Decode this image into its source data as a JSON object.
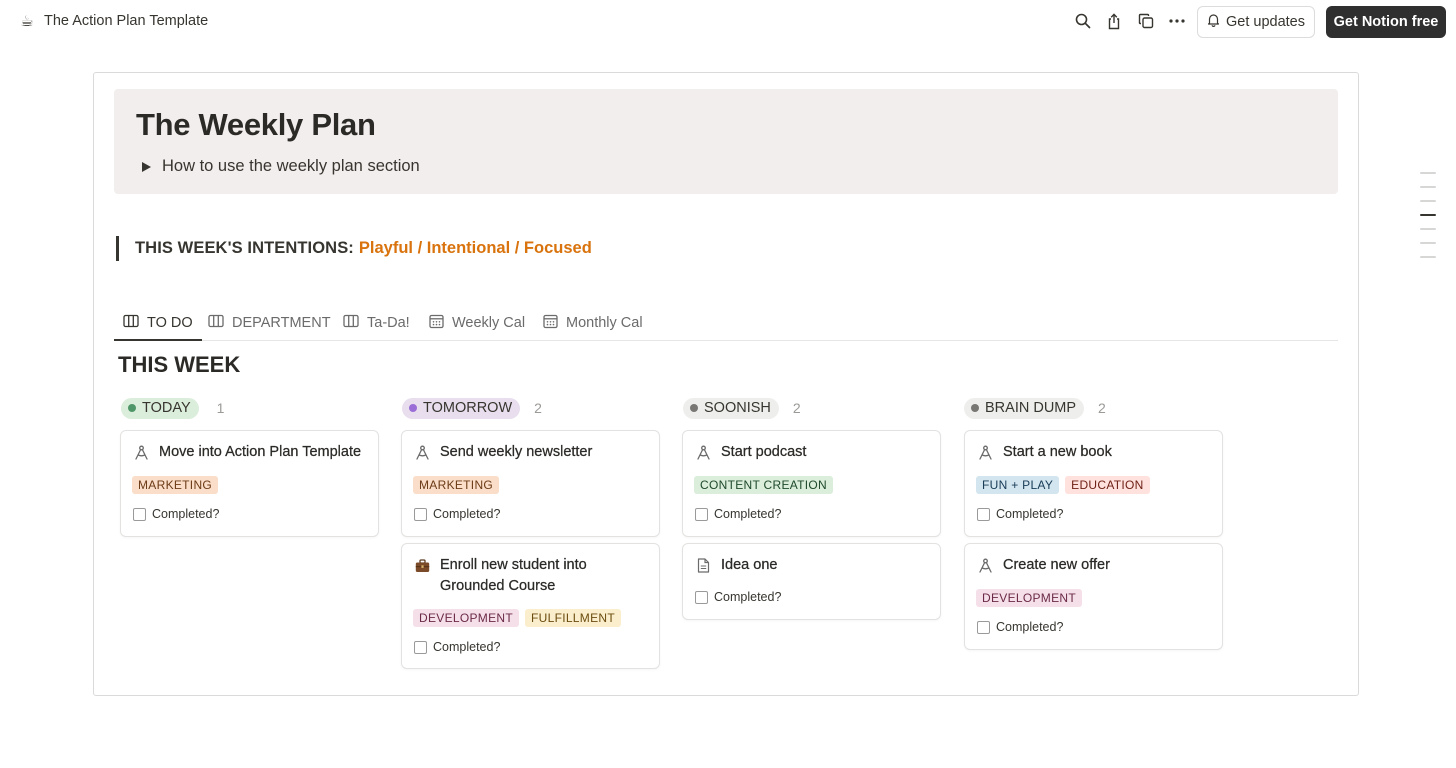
{
  "topbar": {
    "page_icon": "☕",
    "title": "The Action Plan Template",
    "icons": [
      "search-icon",
      "share-icon",
      "duplicate-icon",
      "more-icon"
    ],
    "updates_label": "Get updates",
    "notion_label": "Get Notion free"
  },
  "callout": {
    "title": "The Weekly Plan",
    "toggle_text": "How to use the weekly plan section"
  },
  "intentions": {
    "label": "THIS WEEK'S INTENTIONS:",
    "value": "Playful / Intentional / Focused",
    "value_color": "#d9730d"
  },
  "tabs": [
    {
      "label": "TO DO",
      "icon": "board-icon",
      "active": true
    },
    {
      "label": "DEPARTMENT",
      "icon": "board-icon",
      "active": false
    },
    {
      "label": "Ta-Da!",
      "icon": "board-icon",
      "active": false
    },
    {
      "label": "Weekly Cal",
      "icon": "calendar-icon",
      "active": false
    },
    {
      "label": "Monthly Cal",
      "icon": "calendar-icon",
      "active": false
    }
  ],
  "section_title": "THIS WEEK",
  "checkbox_label": "Completed?",
  "columns": [
    {
      "name": "TODAY",
      "count": "1",
      "pill_color": "#dbeddb",
      "dot_color": "#4f9768",
      "cards": [
        {
          "icon": "compass-icon",
          "title": "Move into Action Plan Template",
          "tags": [
            {
              "label": "MARKETING",
              "bg": "#fadec9",
              "fg": "#6c3b17"
            }
          ]
        }
      ]
    },
    {
      "name": "TOMORROW",
      "count": "2",
      "pill_color": "#e8deee",
      "dot_color": "#9a6dd7",
      "cards": [
        {
          "icon": "compass-icon",
          "title": "Send weekly newsletter",
          "tags": [
            {
              "label": "MARKETING",
              "bg": "#fadec9",
              "fg": "#6c3b17"
            }
          ]
        },
        {
          "icon": "briefcase-icon",
          "title_lines": [
            "Enroll new student into",
            "Grounded Course"
          ],
          "tags": [
            {
              "label": "DEVELOPMENT",
              "bg": "#f5e0e9",
              "fg": "#6b2a47"
            },
            {
              "label": "FULFILLMENT",
              "bg": "#fbeecc",
              "fg": "#6b4c0f"
            }
          ]
        }
      ]
    },
    {
      "name": "SOONISH",
      "count": "2",
      "pill_color": "#eeeeec",
      "dot_color": "#787774",
      "cards": [
        {
          "icon": "compass-icon",
          "title": "Start podcast",
          "tags": [
            {
              "label": "CONTENT CREATION",
              "bg": "#dbeddb",
              "fg": "#1f4a2b"
            }
          ]
        },
        {
          "icon": "document-icon",
          "title": "Idea one",
          "tags": []
        }
      ]
    },
    {
      "name": "BRAIN DUMP",
      "count": "2",
      "pill_color": "#eeeeec",
      "dot_color": "#787774",
      "cards": [
        {
          "icon": "compass-icon",
          "title": "Start a new book",
          "tags": [
            {
              "label": "FUN + PLAY",
              "bg": "#d3e5ef",
              "fg": "#183b56"
            },
            {
              "label": "EDUCATION",
              "bg": "#ffe2dd",
              "fg": "#6e2116"
            }
          ]
        },
        {
          "icon": "compass-icon",
          "title": "Create new offer",
          "tags": [
            {
              "label": "DEVELOPMENT",
              "bg": "#f5e0e9",
              "fg": "#6b2a47"
            }
          ]
        }
      ]
    }
  ]
}
